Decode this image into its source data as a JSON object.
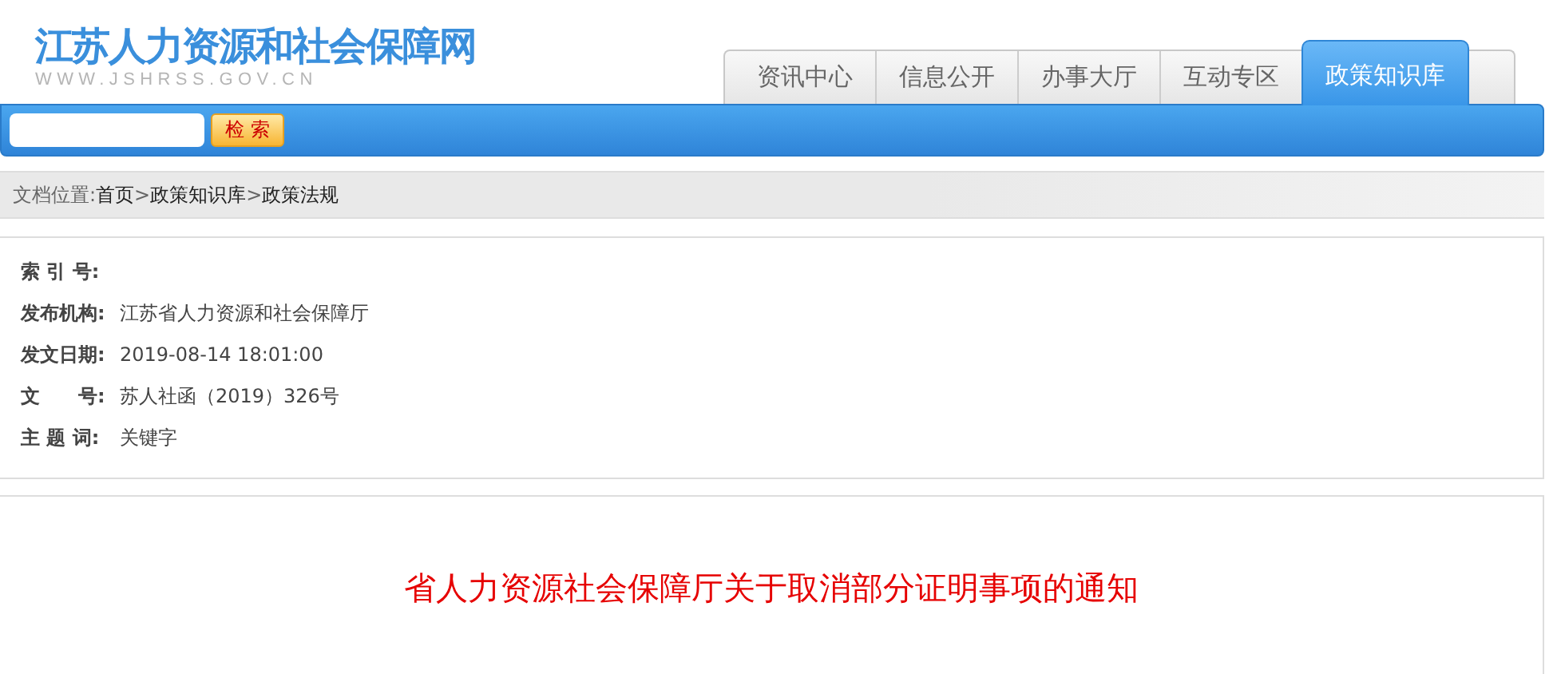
{
  "site": {
    "title": "江苏人力资源和社会保障网",
    "url": "WWW.JSHRSS.GOV.CN"
  },
  "nav_tabs": [
    {
      "label": "资讯中心",
      "selected": false
    },
    {
      "label": "信息公开",
      "selected": false
    },
    {
      "label": "办事大厅",
      "selected": false
    },
    {
      "label": "互动专区",
      "selected": false
    },
    {
      "label": "政策知识库",
      "selected": true
    }
  ],
  "search": {
    "button": "检 索"
  },
  "breadcrumb": {
    "label": "文档位置:",
    "separator": ">",
    "items": [
      "首页",
      "政策知识库",
      "政策法规"
    ]
  },
  "meta": [
    {
      "label": "索 引 号:"
    },
    {
      "label": "发布机构:",
      "value": "江苏省人力资源和社会保障厅"
    },
    {
      "label": "发文日期:",
      "value": "2019-08-14 18:01:00"
    },
    {
      "label": "文　　号:",
      "value": "苏人社函（2019）326号"
    },
    {
      "label": "主 题 词:",
      "value": "关键字"
    }
  ],
  "document_title": "省人力资源社会保障厅关于取消部分证明事项的通知"
}
